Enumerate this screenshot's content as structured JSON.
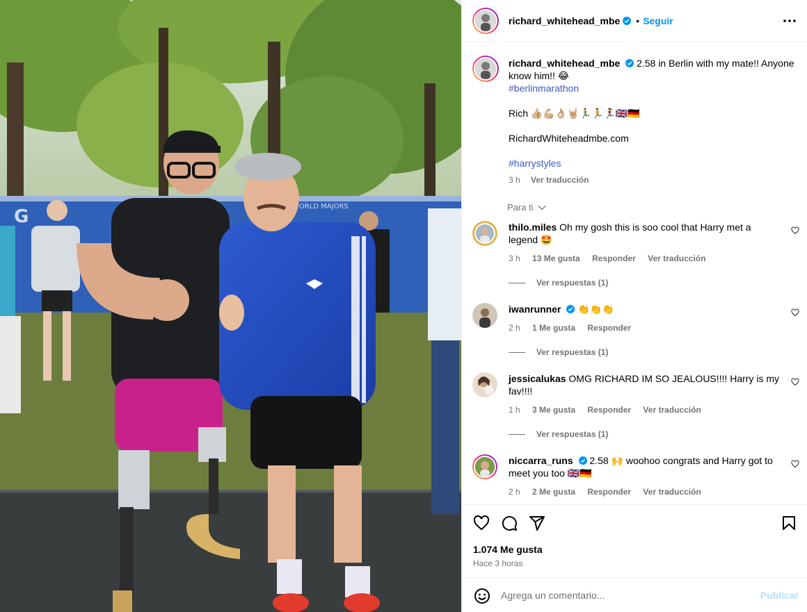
{
  "post": {
    "author": "richard_whitehead_mbe",
    "follow_label": "Seguir",
    "separator": "•",
    "more_icon": "more-horizontal-icon"
  },
  "caption": {
    "author": "richard_whitehead_mbe",
    "text_line1": "2.58 in Berlin with my mate!! Anyone know him!! 😂",
    "hashtag1": "#berlinmarathon",
    "signoff": "Rich 👍🏼💪🏼👌🏼🤘🏼🏃‍♂️🏃🏃‍♀️🇬🇧🇩🇪",
    "website": "RichardWhiteheadmbe.com",
    "hashtag2": "#harrystyles",
    "time": "3 h",
    "translate": "Ver traducción"
  },
  "for_you_label": "Para ti",
  "comments": [
    {
      "user": "thilo.miles",
      "text": "Oh my gosh this is soo cool that Harry met a legend 🤩",
      "time": "3 h",
      "likes": "13 Me gusta",
      "reply": "Responder",
      "translate": "Ver traducción",
      "replies": "Ver respuestas (1)"
    },
    {
      "user": "iwanrunner",
      "text": "👏👏👏",
      "time": "2 h",
      "likes": "1 Me gusta",
      "reply": "Responder",
      "replies": "Ver respuestas (1)"
    },
    {
      "user": "jessicalukas",
      "text": "OMG RICHARD IM SO JEALOUS!!!! Harry is my fav!!!!",
      "time": "1 h",
      "likes": "3 Me gusta",
      "reply": "Responder",
      "translate": "Ver traducción",
      "replies": "Ver respuestas (1)"
    },
    {
      "user": "niccarra_runs",
      "text": "2.58 🙌 woohoo congrats and Harry got to meet you too 🇬🇧🇩🇪",
      "time": "2 h",
      "likes": "2 Me gusta",
      "reply": "Responder",
      "translate": "Ver traducción"
    }
  ],
  "actions": {
    "likes_count": "1.074 Me gusta",
    "posted_ago": "Hace 3 horas"
  },
  "composer": {
    "placeholder": "Agrega un comentario...",
    "publish_label": "Publicar"
  },
  "colors": {
    "follow_blue": "#0095f6",
    "hashtag_blue": "#3a59c4",
    "publish_disabled": "#b2dffc",
    "meta_gray": "#737373"
  }
}
